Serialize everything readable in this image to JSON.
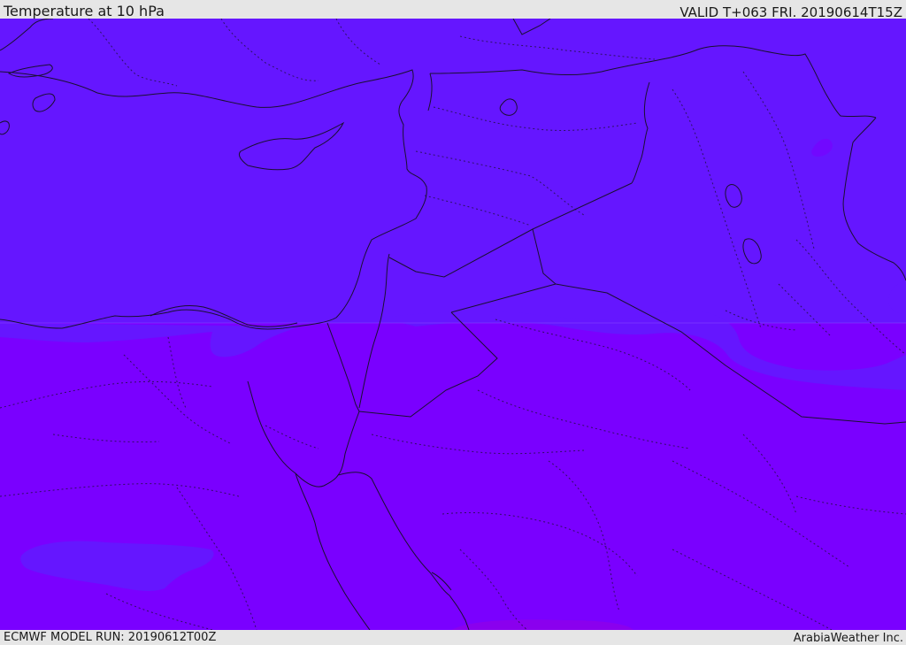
{
  "header": {
    "title": "Temperature at 10 hPa",
    "valid": "VALID T+063 FRI. 20190614T15Z"
  },
  "footer": {
    "model_run": "ECMWF MODEL RUN: 20190612T00Z",
    "credit": "ArabiaWeather Inc."
  },
  "map": {
    "colors": {
      "north_band": "#6516ff",
      "south_band": "#7a00ff",
      "warm_patch": "#8a00ee",
      "coast": "#1a1030"
    }
  }
}
